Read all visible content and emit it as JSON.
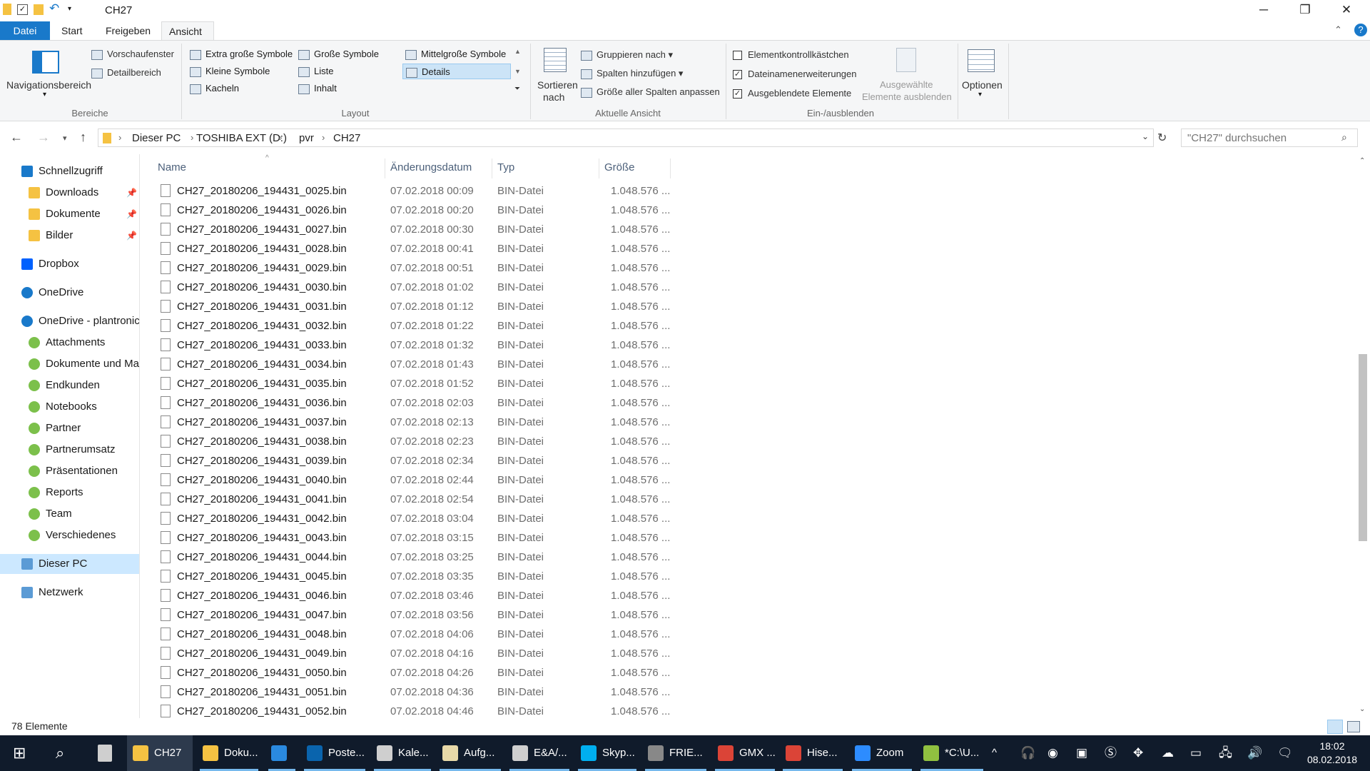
{
  "window": {
    "title": "CH27",
    "minimize": "─",
    "maximize": "❐",
    "close": "✕"
  },
  "ribbon_tabs": [
    {
      "label": "Datei"
    },
    {
      "label": "Start"
    },
    {
      "label": "Freigeben"
    },
    {
      "label": "Ansicht"
    }
  ],
  "ribbon": {
    "bereiche": {
      "title": "Bereiche",
      "nav_pane": "Navigationsbereich",
      "preview": "Vorschaufenster",
      "details": "Detailbereich"
    },
    "layout": {
      "title": "Layout",
      "items": [
        "Extra große Symbole",
        "Große Symbole",
        "Mittelgroße Symbole",
        "Kleine Symbole",
        "Liste",
        "Details",
        "Kacheln",
        "Inhalt"
      ],
      "selected": "Details"
    },
    "aktuelle_ansicht": {
      "title": "Aktuelle Ansicht",
      "sort": "Sortieren",
      "sort2": "nach",
      "group": "Gruppieren nach",
      "add_columns": "Spalten hinzufügen",
      "fit_columns": "Größe aller Spalten anpassen"
    },
    "ein_ausblenden": {
      "title": "Ein-/ausblenden",
      "checkboxes": "Elementkontrollkästchen",
      "extensions": "Dateinamenerweiterungen",
      "hidden": "Ausgeblendete Elemente",
      "hide_selected_1": "Ausgewählte",
      "hide_selected_2": "Elemente ausblenden",
      "checked": {
        "checkboxes": false,
        "extensions": true,
        "hidden": true
      }
    },
    "options": "Optionen"
  },
  "address": {
    "crumbs": [
      "Dieser PC",
      "TOSHIBA EXT (D:)",
      "pvr",
      "CH27"
    ],
    "search_placeholder": "\"CH27\" durchsuchen"
  },
  "nav_pane": [
    {
      "label": "Schnellzugriff",
      "icon": "star-icon"
    },
    {
      "label": "Downloads",
      "icon": "downloads-folder-icon",
      "pinned": true
    },
    {
      "label": "Dokumente",
      "icon": "documents-folder-icon",
      "pinned": true
    },
    {
      "label": "Bilder",
      "icon": "pictures-folder-icon",
      "pinned": true
    },
    {
      "label": "Dropbox",
      "icon": "dropbox-icon"
    },
    {
      "label": "OneDrive",
      "icon": "cloud-icon"
    },
    {
      "label": "OneDrive - plantronics",
      "icon": "cloud-icon"
    },
    {
      "label": "Attachments",
      "icon": "synced-folder-icon"
    },
    {
      "label": "Dokumente und Ma",
      "icon": "synced-folder-icon"
    },
    {
      "label": "Endkunden",
      "icon": "synced-folder-icon"
    },
    {
      "label": "Notebooks",
      "icon": "synced-folder-icon"
    },
    {
      "label": "Partner",
      "icon": "synced-folder-icon"
    },
    {
      "label": "Partnerumsatz",
      "icon": "synced-folder-icon"
    },
    {
      "label": "Präsentationen",
      "icon": "synced-folder-icon"
    },
    {
      "label": "Reports",
      "icon": "synced-folder-icon"
    },
    {
      "label": "Team",
      "icon": "synced-folder-icon"
    },
    {
      "label": "Verschiedenes",
      "icon": "synced-folder-icon"
    },
    {
      "label": "Dieser PC",
      "icon": "computer-icon",
      "selected": true
    },
    {
      "label": "Netzwerk",
      "icon": "network-icon"
    }
  ],
  "columns": {
    "name": "Name",
    "date": "Änderungsdatum",
    "type": "Typ",
    "size": "Größe"
  },
  "files": [
    {
      "name": "CH27_20180206_194431_0025.bin",
      "date": "07.02.2018 00:09",
      "type": "BIN-Datei",
      "size": "1.048.576 ..."
    },
    {
      "name": "CH27_20180206_194431_0026.bin",
      "date": "07.02.2018 00:20",
      "type": "BIN-Datei",
      "size": "1.048.576 ..."
    },
    {
      "name": "CH27_20180206_194431_0027.bin",
      "date": "07.02.2018 00:30",
      "type": "BIN-Datei",
      "size": "1.048.576 ..."
    },
    {
      "name": "CH27_20180206_194431_0028.bin",
      "date": "07.02.2018 00:41",
      "type": "BIN-Datei",
      "size": "1.048.576 ..."
    },
    {
      "name": "CH27_20180206_194431_0029.bin",
      "date": "07.02.2018 00:51",
      "type": "BIN-Datei",
      "size": "1.048.576 ..."
    },
    {
      "name": "CH27_20180206_194431_0030.bin",
      "date": "07.02.2018 01:02",
      "type": "BIN-Datei",
      "size": "1.048.576 ..."
    },
    {
      "name": "CH27_20180206_194431_0031.bin",
      "date": "07.02.2018 01:12",
      "type": "BIN-Datei",
      "size": "1.048.576 ..."
    },
    {
      "name": "CH27_20180206_194431_0032.bin",
      "date": "07.02.2018 01:22",
      "type": "BIN-Datei",
      "size": "1.048.576 ..."
    },
    {
      "name": "CH27_20180206_194431_0033.bin",
      "date": "07.02.2018 01:32",
      "type": "BIN-Datei",
      "size": "1.048.576 ..."
    },
    {
      "name": "CH27_20180206_194431_0034.bin",
      "date": "07.02.2018 01:43",
      "type": "BIN-Datei",
      "size": "1.048.576 ..."
    },
    {
      "name": "CH27_20180206_194431_0035.bin",
      "date": "07.02.2018 01:52",
      "type": "BIN-Datei",
      "size": "1.048.576 ..."
    },
    {
      "name": "CH27_20180206_194431_0036.bin",
      "date": "07.02.2018 02:03",
      "type": "BIN-Datei",
      "size": "1.048.576 ..."
    },
    {
      "name": "CH27_20180206_194431_0037.bin",
      "date": "07.02.2018 02:13",
      "type": "BIN-Datei",
      "size": "1.048.576 ..."
    },
    {
      "name": "CH27_20180206_194431_0038.bin",
      "date": "07.02.2018 02:23",
      "type": "BIN-Datei",
      "size": "1.048.576 ..."
    },
    {
      "name": "CH27_20180206_194431_0039.bin",
      "date": "07.02.2018 02:34",
      "type": "BIN-Datei",
      "size": "1.048.576 ..."
    },
    {
      "name": "CH27_20180206_194431_0040.bin",
      "date": "07.02.2018 02:44",
      "type": "BIN-Datei",
      "size": "1.048.576 ..."
    },
    {
      "name": "CH27_20180206_194431_0041.bin",
      "date": "07.02.2018 02:54",
      "type": "BIN-Datei",
      "size": "1.048.576 ..."
    },
    {
      "name": "CH27_20180206_194431_0042.bin",
      "date": "07.02.2018 03:04",
      "type": "BIN-Datei",
      "size": "1.048.576 ..."
    },
    {
      "name": "CH27_20180206_194431_0043.bin",
      "date": "07.02.2018 03:15",
      "type": "BIN-Datei",
      "size": "1.048.576 ..."
    },
    {
      "name": "CH27_20180206_194431_0044.bin",
      "date": "07.02.2018 03:25",
      "type": "BIN-Datei",
      "size": "1.048.576 ..."
    },
    {
      "name": "CH27_20180206_194431_0045.bin",
      "date": "07.02.2018 03:35",
      "type": "BIN-Datei",
      "size": "1.048.576 ..."
    },
    {
      "name": "CH27_20180206_194431_0046.bin",
      "date": "07.02.2018 03:46",
      "type": "BIN-Datei",
      "size": "1.048.576 ..."
    },
    {
      "name": "CH27_20180206_194431_0047.bin",
      "date": "07.02.2018 03:56",
      "type": "BIN-Datei",
      "size": "1.048.576 ..."
    },
    {
      "name": "CH27_20180206_194431_0048.bin",
      "date": "07.02.2018 04:06",
      "type": "BIN-Datei",
      "size": "1.048.576 ..."
    },
    {
      "name": "CH27_20180206_194431_0049.bin",
      "date": "07.02.2018 04:16",
      "type": "BIN-Datei",
      "size": "1.048.576 ..."
    },
    {
      "name": "CH27_20180206_194431_0050.bin",
      "date": "07.02.2018 04:26",
      "type": "BIN-Datei",
      "size": "1.048.576 ..."
    },
    {
      "name": "CH27_20180206_194431_0051.bin",
      "date": "07.02.2018 04:36",
      "type": "BIN-Datei",
      "size": "1.048.576 ..."
    },
    {
      "name": "CH27_20180206_194431_0052.bin",
      "date": "07.02.2018 04:46",
      "type": "BIN-Datei",
      "size": "1.048.576 ..."
    }
  ],
  "status": {
    "count": "78 Elemente"
  },
  "taskbar": {
    "apps": [
      {
        "label": "CH27",
        "icon": "explorer-folder-icon",
        "color": "#f5c242",
        "state": "active"
      },
      {
        "label": "Doku...",
        "icon": "explorer-folder-icon",
        "color": "#f5c242",
        "state": "open"
      },
      {
        "label": "",
        "icon": "internet-explorer-icon",
        "color": "#2a8ae0",
        "state": "open"
      },
      {
        "label": "Poste...",
        "icon": "outlook-icon",
        "color": "#0a64ad",
        "state": "open"
      },
      {
        "label": "Kale...",
        "icon": "calendar-icon",
        "color": "#cfcfcf",
        "state": "open"
      },
      {
        "label": "Aufg...",
        "icon": "tasks-icon",
        "color": "#e8d9a8",
        "state": "open"
      },
      {
        "label": "E&A/...",
        "icon": "spreadsheet-icon",
        "color": "#cfcfcf",
        "state": "open"
      },
      {
        "label": "Skyp...",
        "icon": "skype-icon",
        "color": "#00aff0",
        "state": "open"
      },
      {
        "label": "FRIE...",
        "icon": "chat-window-icon",
        "color": "#888888",
        "state": "open"
      },
      {
        "label": "GMX ...",
        "icon": "chrome-icon",
        "color": "#db4437",
        "state": "open"
      },
      {
        "label": "Hise...",
        "icon": "chrome-icon",
        "color": "#db4437",
        "state": "open"
      },
      {
        "label": "Zoom",
        "icon": "zoom-icon",
        "color": "#2d8cff",
        "state": "open"
      },
      {
        "label": "*C:\\U...",
        "icon": "notepad-plus-icon",
        "color": "#90c040",
        "state": "open"
      }
    ],
    "time": "18:02",
    "date": "08.02.2018"
  }
}
